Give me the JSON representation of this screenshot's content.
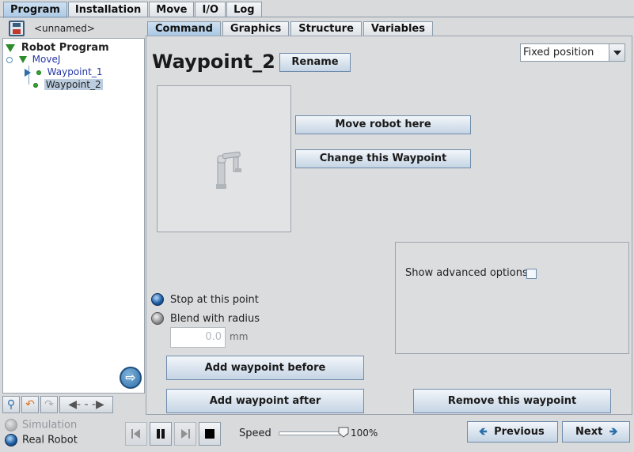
{
  "main_tabs": [
    "Program",
    "Installation",
    "Move",
    "I/O",
    "Log"
  ],
  "program": {
    "name": "<unnamed>"
  },
  "tree": {
    "root": "Robot Program",
    "movej": "MoveJ",
    "waypoints": [
      "Waypoint_1",
      "Waypoint_2"
    ],
    "selected": "Waypoint_2"
  },
  "sub_tabs": [
    "Command",
    "Graphics",
    "Structure",
    "Variables"
  ],
  "waypoint": {
    "title": "Waypoint_2",
    "rename_label": "Rename",
    "position_type": "Fixed position",
    "move_robot_label": "Move robot here",
    "change_label": "Change this Waypoint",
    "advanced_label": "Show advanced options",
    "stop_label": "Stop at this point",
    "blend_label": "Blend with radius",
    "radius_value": "0.0",
    "radius_unit": "mm",
    "add_before_label": "Add waypoint before",
    "add_after_label": "Add waypoint after",
    "remove_label": "Remove this waypoint"
  },
  "footer": {
    "simulation_label": "Simulation",
    "real_robot_label": "Real Robot",
    "speed_label": "Speed",
    "speed_value": "100%",
    "previous_label": "Previous",
    "next_label": "Next"
  },
  "icons": {
    "save": "save-icon",
    "goto": "arrow-right-icon",
    "search": "magnifier-icon",
    "undo": "undo-icon",
    "redo": "redo-icon",
    "cut": "cut-icon"
  },
  "colors": {
    "tab_active": "#aac8e4",
    "tree_selected": "#bccde0",
    "accent": "#1e5ea3"
  }
}
